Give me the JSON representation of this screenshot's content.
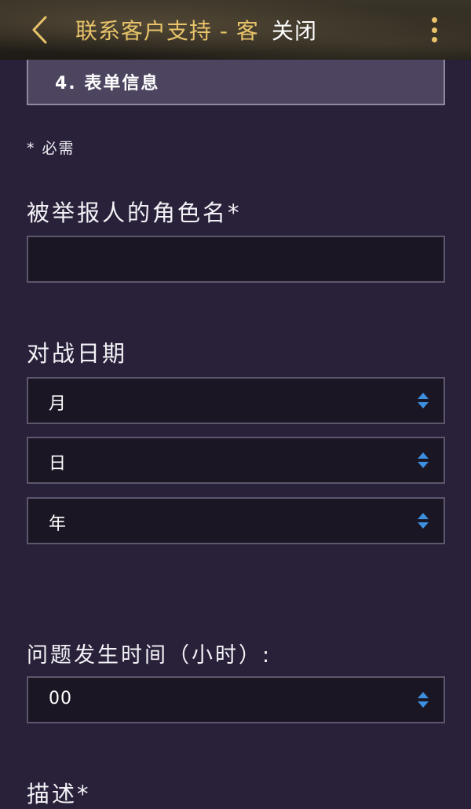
{
  "header": {
    "title": "联系客户支持 - 客",
    "close_label": "关闭",
    "accent_color": "#e8c36a"
  },
  "form": {
    "section_title": "4. 表单信息",
    "required_note": "* 必需",
    "reported_name": {
      "label": "被举报人的角色名*",
      "value": ""
    },
    "match_date": {
      "label": "对战日期",
      "month": "月",
      "day": "日",
      "year": "年"
    },
    "issue_hour": {
      "label": "问题发生时间（小时）:",
      "value": "00"
    },
    "description": {
      "label": "描述*"
    }
  },
  "icons": {
    "back": "chevron-left-icon",
    "more": "more-vertical-icon",
    "select": "select-arrows-icon"
  }
}
